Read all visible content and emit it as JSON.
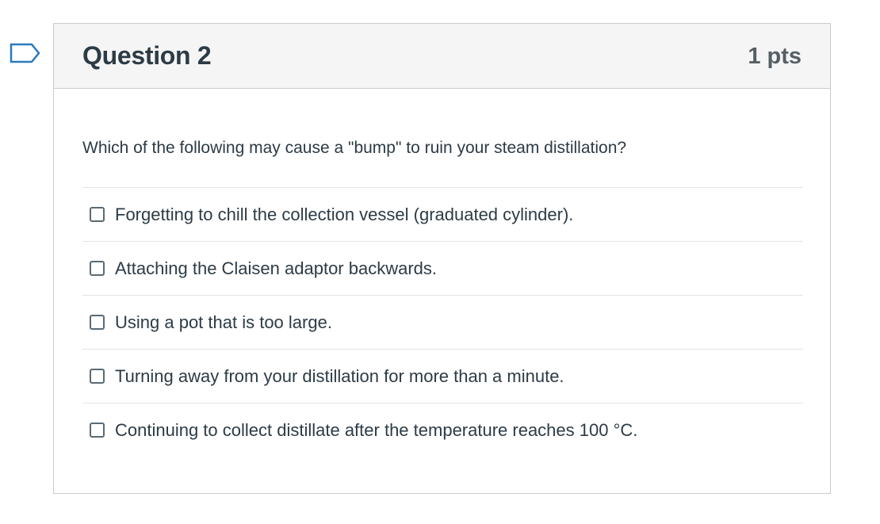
{
  "question": {
    "title": "Question 2",
    "points": "1 pts",
    "text": "Which of the following may cause a \"bump\" to ruin your steam distillation?",
    "flag_icon": "bookmark-flag-icon",
    "answers": [
      {
        "label": "Forgetting to chill the collection vessel (graduated cylinder).",
        "checked": false
      },
      {
        "label": "Attaching the Claisen adaptor backwards.",
        "checked": false
      },
      {
        "label": "Using a pot that is too large.",
        "checked": false
      },
      {
        "label": "Turning away from your distillation for more than a minute.",
        "checked": false
      },
      {
        "label": "Continuing to collect distillate after the temperature reaches 100 °C.",
        "checked": false
      }
    ]
  },
  "colors": {
    "flag_outline": "#2b7abc",
    "header_bg": "#f5f5f5",
    "border": "#c7cdd1",
    "text": "#2d3b45"
  }
}
